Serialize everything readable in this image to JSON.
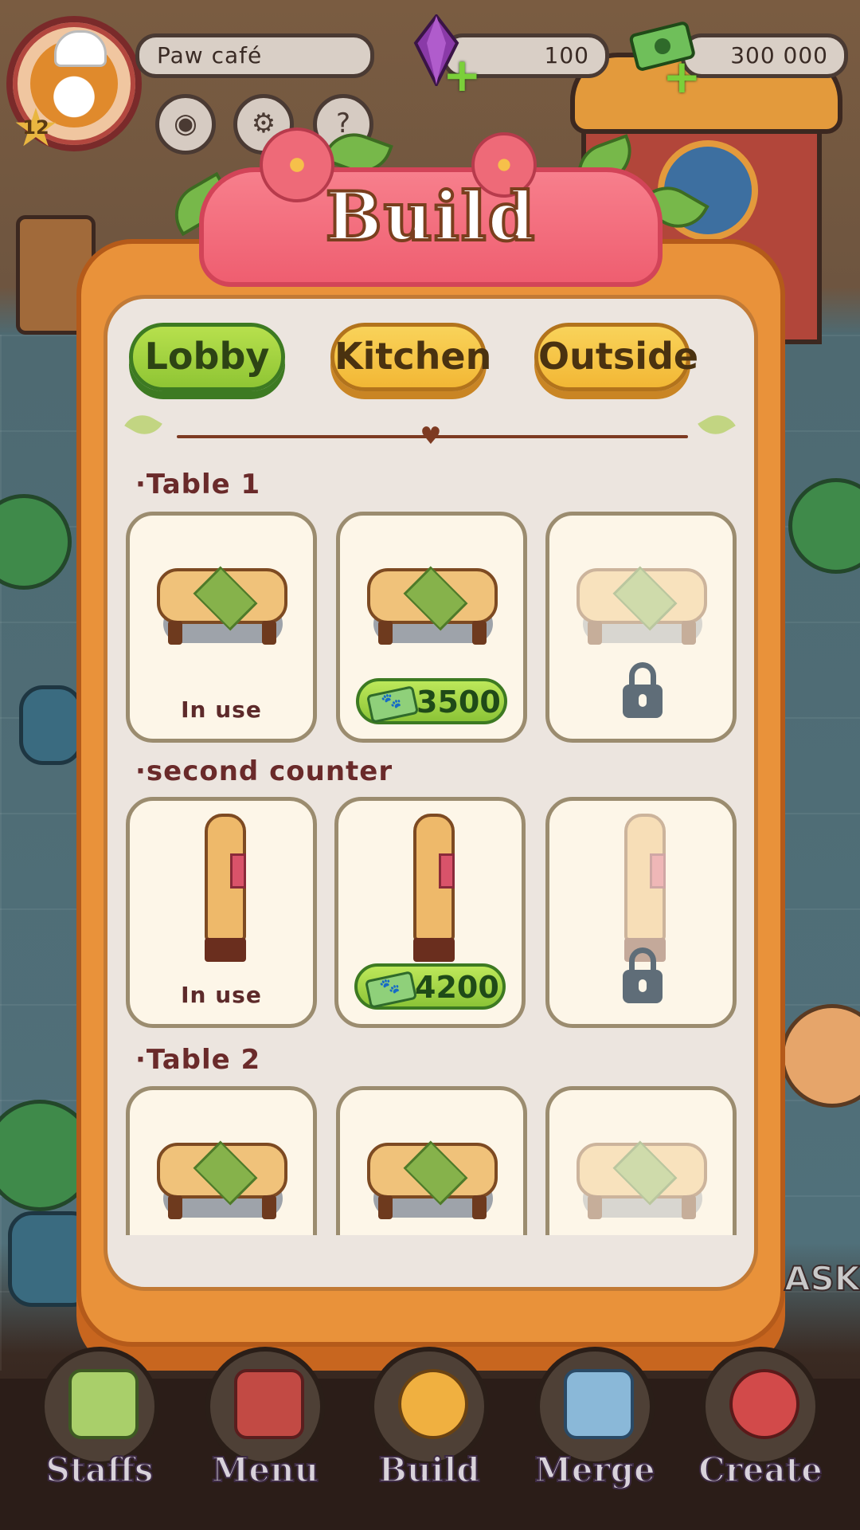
{
  "hud": {
    "level": "12",
    "cafe_name": "Paw café",
    "gems": "100",
    "cash": "300 000"
  },
  "modal": {
    "title": "Build",
    "tabs": [
      {
        "label": "Lobby",
        "active": true
      },
      {
        "label": "Kitchen",
        "active": false
      },
      {
        "label": "Outside",
        "active": false
      }
    ],
    "sections": [
      {
        "title": "·Table 1",
        "items": [
          {
            "state": "in_use",
            "caption": "In use"
          },
          {
            "state": "buy",
            "price": "3500"
          },
          {
            "state": "locked"
          }
        ]
      },
      {
        "title": "·second counter",
        "items": [
          {
            "state": "in_use",
            "caption": "In use"
          },
          {
            "state": "buy",
            "price": "4200"
          },
          {
            "state": "locked"
          }
        ]
      },
      {
        "title": "·Table 2",
        "items": [
          {
            "state": "visible"
          },
          {
            "state": "visible"
          },
          {
            "state": "faded"
          }
        ]
      }
    ]
  },
  "side_label": "ASKS",
  "nav": [
    {
      "label": "Staffs",
      "icon": "calendar-bunny-icon"
    },
    {
      "label": "Menu",
      "icon": "menu-book-icon"
    },
    {
      "label": "Build",
      "icon": "build-shiba-icon"
    },
    {
      "label": "Merge",
      "icon": "merge-cups-icon"
    },
    {
      "label": "Create",
      "icon": "mixing-bowl-icon"
    }
  ],
  "colors": {
    "tab_active": "#9acd3a",
    "tab_idle": "#f4c141",
    "title_banner": "#f2687a",
    "modal_frame": "#e9923a",
    "price_pill": "#a5d648",
    "lock": "#5f6d78"
  }
}
